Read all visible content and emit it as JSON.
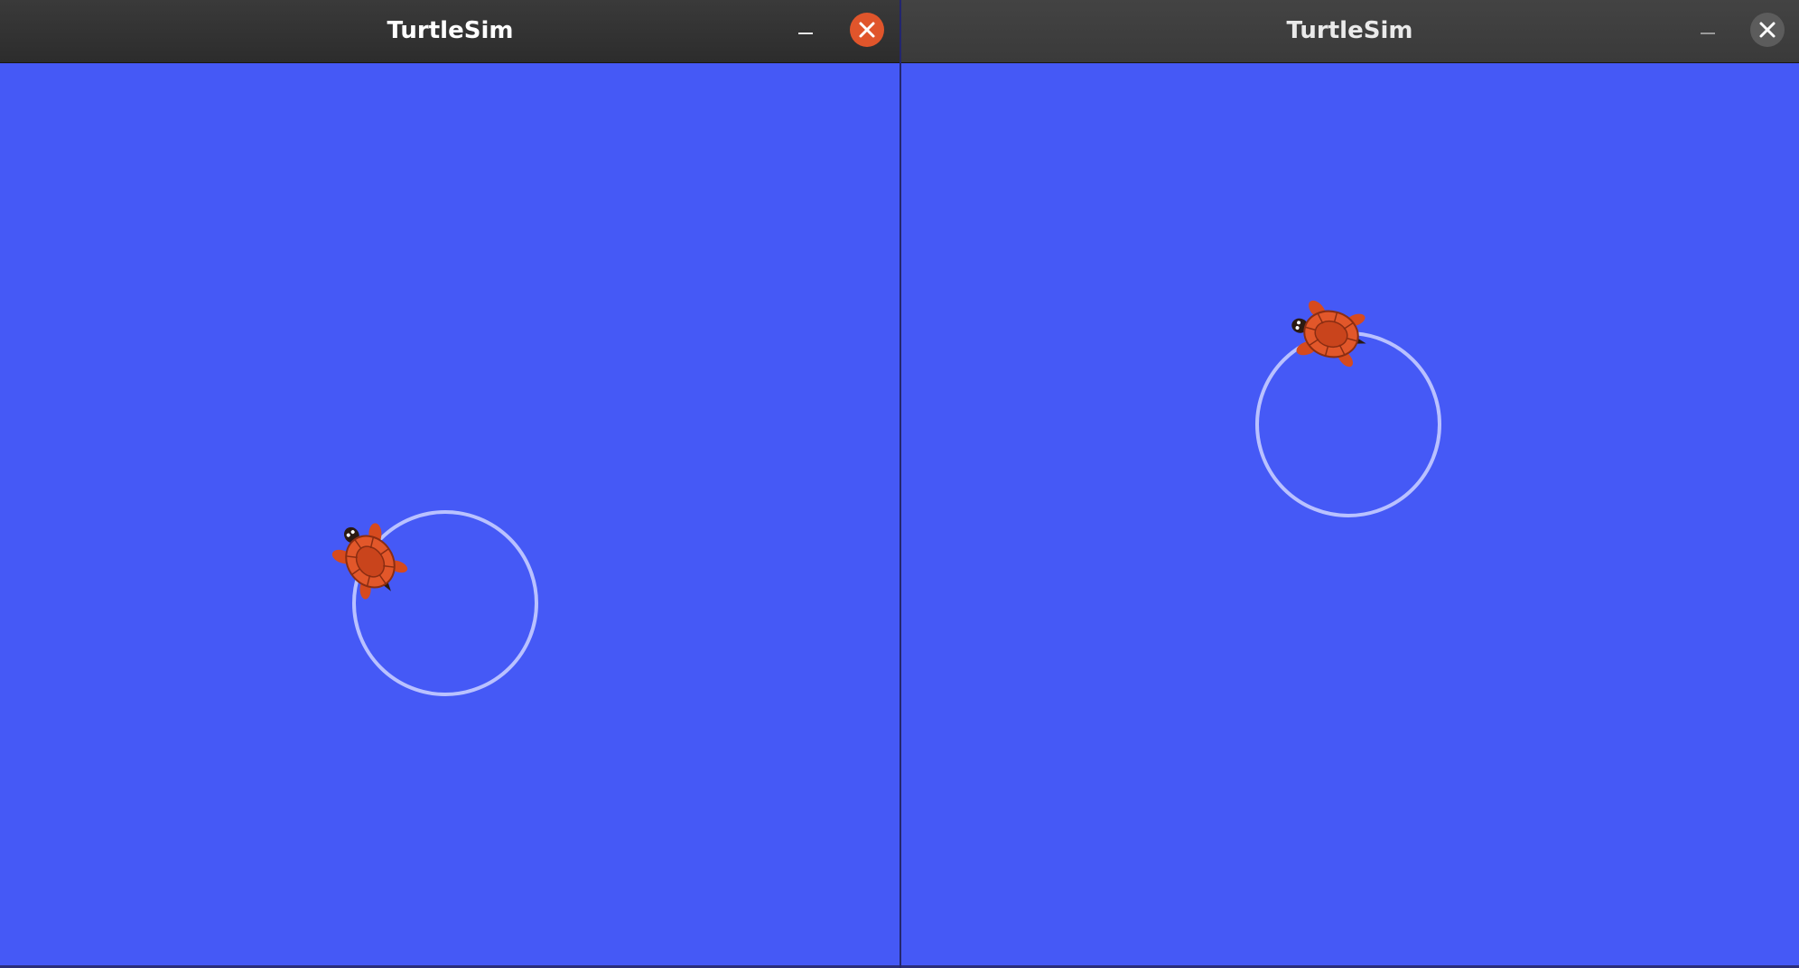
{
  "windows": [
    {
      "title": "TurtleSim",
      "active": true,
      "background_color": "#4559f6",
      "pen_color": "#b9c1ff",
      "controls": {
        "minimize_icon": "minimize-icon",
        "close_icon": "close-icon",
        "close_color": "#e0552b"
      }
    },
    {
      "title": "TurtleSim",
      "active": false,
      "background_color": "#4559f6",
      "pen_color": "#b9c1ff",
      "controls": {
        "minimize_icon": "minimize-icon",
        "close_icon": "close-icon",
        "close_color": "#5c5c5c"
      }
    }
  ],
  "icons": {
    "turtle": "turtle-icon"
  }
}
